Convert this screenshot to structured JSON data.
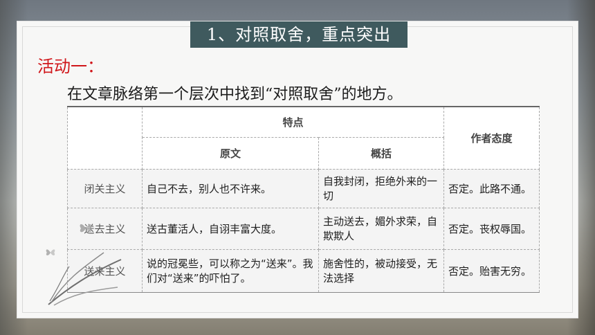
{
  "slide": {
    "title": "1、对照取舍，重点突出",
    "activity_label": "活动一：",
    "instruction": "在文章脉络第一个层次中找到“对照取舍”的地方。"
  },
  "table": {
    "header_group": "特点",
    "header_original": "原文",
    "header_summary": "概括",
    "header_attitude": "作者态度",
    "rows": [
      {
        "label": "闭关主义",
        "original": "自己不去，别人也不许来。",
        "summary": "自我封闭，拒绝外来的一切",
        "attitude": "否定。此路不通。"
      },
      {
        "label": "送去主义",
        "original": "送古董活人，自诩丰富大度。",
        "summary": "主动送去，媚外求荣，自欺欺人",
        "attitude": "否定。丧权辱国。"
      },
      {
        "label": "送来主义",
        "original": "说的冠冕些，可以称之为“送来”。我们对“送来”的吓怕了。",
        "summary": "施舍性的，被动接受，无法选择",
        "attitude": "否定。贻害无穷。"
      }
    ]
  },
  "colors": {
    "title_badge_bg": "#3f5a5e",
    "activity_red": "#d0161a"
  }
}
